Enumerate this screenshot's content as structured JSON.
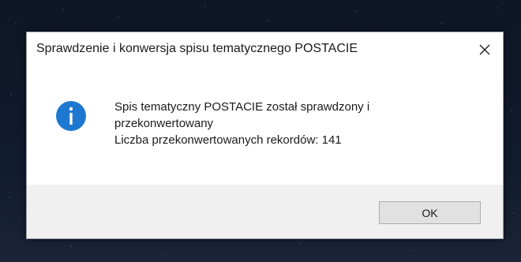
{
  "dialog": {
    "title": "Sprawdzenie i konwersja spisu tematycznego POSTACIE",
    "close_symbol": "close-icon",
    "icon": "info-icon",
    "message_lines": [
      "Spis tematyczny POSTACIE został sprawdzony i",
      "przekonwertowany",
      "Liczba przekonwertowanych rekordów: 141"
    ],
    "ok_label": "OK"
  },
  "colors": {
    "info_icon_bg": "#1e78d0",
    "button_bg": "#e1e1e1",
    "footer_bg": "#f0f0f0"
  }
}
